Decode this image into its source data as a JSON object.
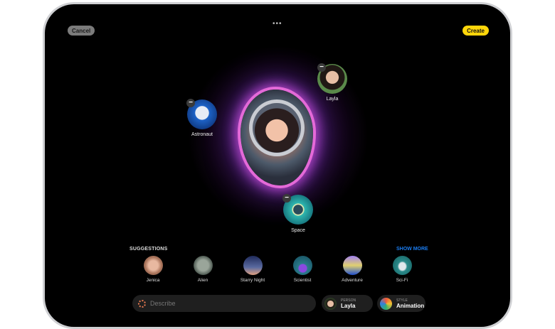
{
  "header": {
    "cancel": "Cancel",
    "create": "Create",
    "more": "•••"
  },
  "canvas": {
    "bubbles": [
      {
        "label": "Astronaut",
        "icon": "astronaut-icon"
      },
      {
        "label": "Layla",
        "icon": "person-photo"
      },
      {
        "label": "Space",
        "icon": "planet-icon"
      }
    ],
    "remove": "−"
  },
  "suggestions": {
    "title": "SUGGESTIONS",
    "show_more": "SHOW MORE",
    "items": [
      {
        "label": "Jenica"
      },
      {
        "label": "Alien"
      },
      {
        "label": "Starry Night"
      },
      {
        "label": "Scientist"
      },
      {
        "label": "Adventure"
      },
      {
        "label": "Sci-Fi"
      }
    ]
  },
  "bottom": {
    "describe_placeholder": "Describe",
    "person": {
      "key": "PERSON",
      "value": "Layla"
    },
    "style": {
      "key": "STYLE",
      "value": "Animation"
    }
  },
  "colors": {
    "accent": "#ffd60a",
    "link": "#1a7cf0",
    "glow": "#c04ad0"
  }
}
